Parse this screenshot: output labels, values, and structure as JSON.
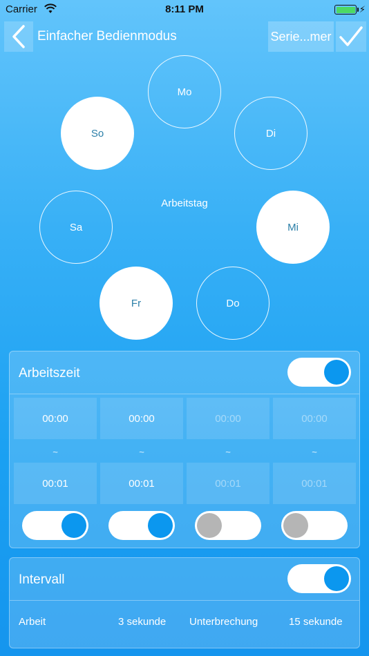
{
  "status_bar": {
    "carrier": "Carrier",
    "time": "8:11 PM"
  },
  "nav": {
    "title": "Einfacher Bedienmodus",
    "series_button": "Serie...mer"
  },
  "days": {
    "center_label": "Arbeitstag",
    "items": [
      {
        "label": "Mo",
        "selected": false
      },
      {
        "label": "Di",
        "selected": false
      },
      {
        "label": "Mi",
        "selected": true
      },
      {
        "label": "Do",
        "selected": false
      },
      {
        "label": "Fr",
        "selected": true
      },
      {
        "label": "Sa",
        "selected": false
      },
      {
        "label": "So",
        "selected": true
      }
    ]
  },
  "work_time": {
    "title": "Arbeitszeit",
    "enabled": true,
    "separator": "~",
    "slots": [
      {
        "start": "00:00",
        "end": "00:01",
        "enabled": true
      },
      {
        "start": "00:00",
        "end": "00:01",
        "enabled": true
      },
      {
        "start": "00:00",
        "end": "00:01",
        "enabled": false
      },
      {
        "start": "00:00",
        "end": "00:01",
        "enabled": false
      }
    ]
  },
  "interval": {
    "title": "Intervall",
    "enabled": true,
    "work_label": "Arbeit",
    "work_value": "3 sekunde",
    "pause_label": "Unterbrechung",
    "pause_value": "15 sekunde"
  },
  "colors": {
    "accent": "#0b97ef",
    "selected_text": "#2b7fa8",
    "disabled_knob": "#b5b5b5"
  }
}
